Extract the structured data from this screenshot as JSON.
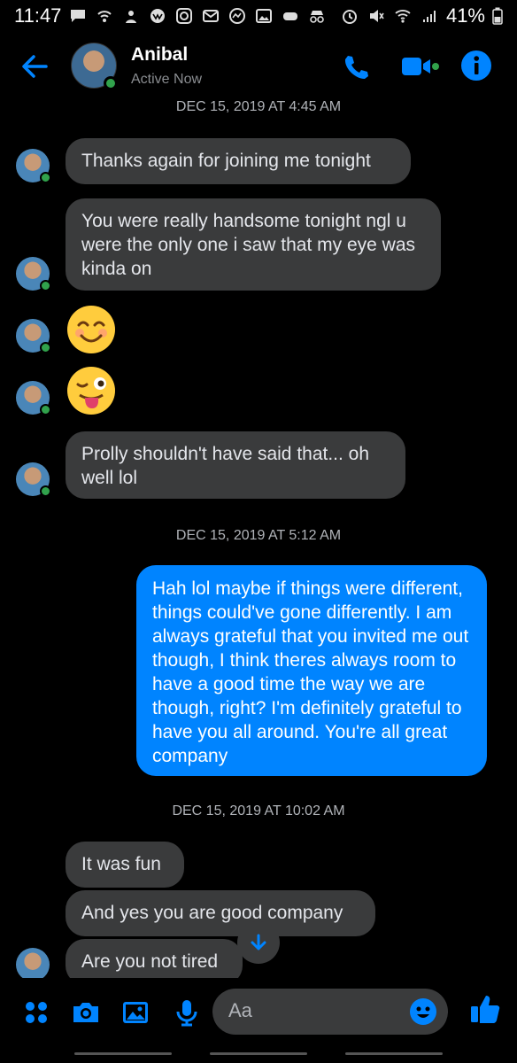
{
  "status_bar": {
    "time": "11:47",
    "battery": "41%"
  },
  "header": {
    "name": "Anibal",
    "status": "Active Now"
  },
  "timestamps": [
    "DEC 15, 2019 AT 4:45 AM",
    "DEC 15, 2019 AT 5:12 AM",
    "DEC 15, 2019 AT 10:02 AM"
  ],
  "messages": {
    "m1": "Thanks again for joining me tonight",
    "m2": "You were really handsome tonight ngl u were the only one i saw that my eye was kinda on",
    "m3_emoji": "smiling-face-emoji",
    "m4_emoji": "winking-tongue-emoji",
    "m5": "Prolly shouldn't have said that... oh well lol",
    "m6": "Hah lol maybe if things were different, things could've gone differently. I am always grateful that you invited me out though, I think theres always room to have a good time the way we are though, right? I'm definitely grateful to have you all around. You're all great company",
    "m7": "It was fun",
    "m8": "And yes you are good company",
    "m9": "Are you not tired"
  },
  "composer": {
    "placeholder": "Aa"
  },
  "colors": {
    "accent": "#0084ff",
    "incoming_bubble": "#3a3b3c",
    "online": "#31a24c"
  }
}
